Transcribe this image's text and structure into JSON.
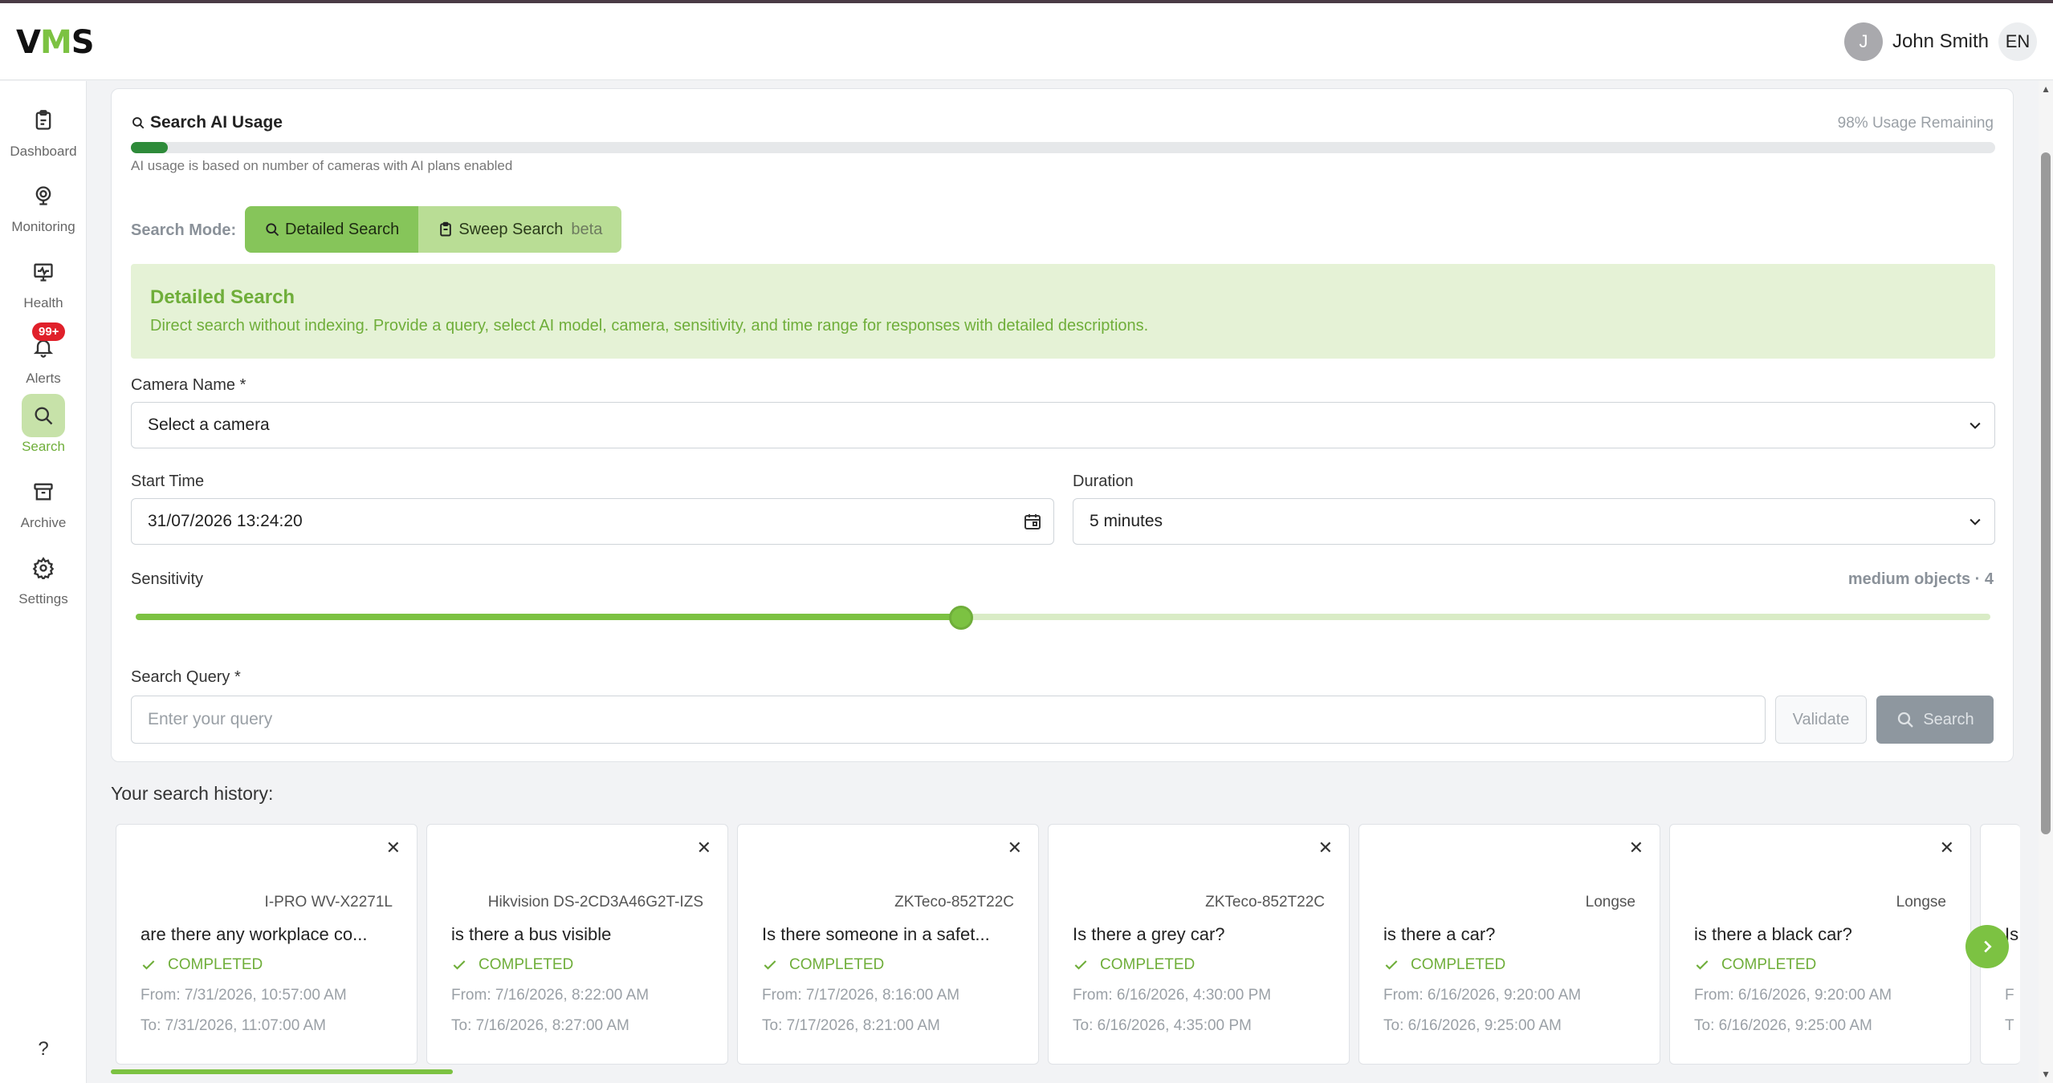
{
  "app": {
    "logo_v": "V",
    "logo_m": "M",
    "logo_s": "S"
  },
  "user": {
    "initial": "J",
    "name": "John Smith",
    "lang": "EN"
  },
  "sidebar": {
    "items": [
      {
        "label": "Dashboard",
        "icon": "clipboard-icon"
      },
      {
        "label": "Monitoring",
        "icon": "webcam-icon"
      },
      {
        "label": "Health",
        "icon": "monitor-pulse-icon"
      },
      {
        "label": "Alerts",
        "icon": "bell-icon",
        "badge": "99+"
      },
      {
        "label": "Search",
        "icon": "search-icon",
        "active": true
      },
      {
        "label": "Archive",
        "icon": "archive-icon"
      },
      {
        "label": "Settings",
        "icon": "gear-icon"
      }
    ],
    "help": "?"
  },
  "usage": {
    "title": "Search AI Usage",
    "remaining": "98% Usage Remaining",
    "used_fraction": 0.02,
    "note": "AI usage is based on number of cameras with AI plans enabled"
  },
  "mode": {
    "label": "Search Mode:",
    "detailed": "Detailed Search",
    "sweep": "Sweep Search",
    "beta": "beta"
  },
  "info": {
    "title": "Detailed Search",
    "text": "Direct search without indexing. Provide a query, select AI model, camera, sensitivity, and time range for responses with detailed descriptions."
  },
  "form": {
    "camera_label": "Camera Name *",
    "camera_value": "Select a camera",
    "start_label": "Start Time",
    "start_value": "31/07/2026 13:24:20",
    "duration_label": "Duration",
    "duration_value": "5 minutes",
    "sensitivity_label": "Sensitivity",
    "sensitivity_value": "medium objects · 4",
    "sensitivity_fraction": 0.445,
    "query_label": "Search Query *",
    "query_placeholder": "Enter your query",
    "validate": "Validate",
    "search": "Search"
  },
  "history": {
    "title": "Your search history:",
    "items": [
      {
        "camera": "I-PRO WV-X2271L",
        "query": "are there any workplace co...",
        "status": "COMPLETED",
        "from": "From: 7/31/2026, 10:57:00 AM",
        "to": "To: 7/31/2026, 11:07:00 AM"
      },
      {
        "camera": "Hikvision DS-2CD3A46G2T-IZS",
        "query": "is there a bus visible",
        "status": "COMPLETED",
        "from": "From: 7/16/2026, 8:22:00 AM",
        "to": "To: 7/16/2026, 8:27:00 AM"
      },
      {
        "camera": "ZKTeco-852T22C",
        "query": "Is there someone in a safet...",
        "status": "COMPLETED",
        "from": "From: 7/17/2026, 8:16:00 AM",
        "to": "To: 7/17/2026, 8:21:00 AM"
      },
      {
        "camera": "ZKTeco-852T22C",
        "query": "Is there a grey car?",
        "status": "COMPLETED",
        "from": "From: 6/16/2026, 4:30:00 PM",
        "to": "To: 6/16/2026, 4:35:00 PM"
      },
      {
        "camera": "Longse",
        "query": "is there a car?",
        "status": "COMPLETED",
        "from": "From: 6/16/2026, 9:20:00 AM",
        "to": "To: 6/16/2026, 9:25:00 AM"
      },
      {
        "camera": "Longse",
        "query": "is there a black car?",
        "status": "COMPLETED",
        "from": "From: 6/16/2026, 9:20:00 AM",
        "to": "To: 6/16/2026, 9:25:00 AM"
      }
    ],
    "partial": {
      "query": "Is",
      "from": "F",
      "to": "T"
    }
  }
}
